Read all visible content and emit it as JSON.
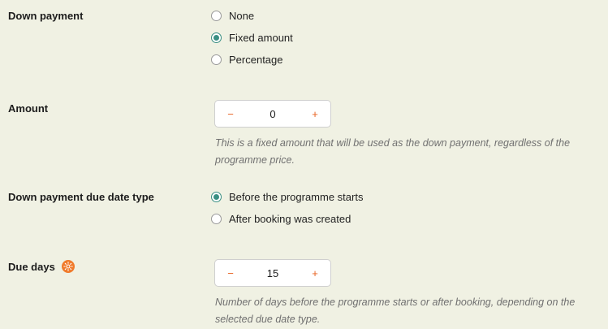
{
  "down_payment": {
    "label": "Down payment",
    "options": [
      {
        "label": "None",
        "checked": false
      },
      {
        "label": "Fixed amount",
        "checked": true
      },
      {
        "label": "Percentage",
        "checked": false
      }
    ]
  },
  "amount": {
    "label": "Amount",
    "value": "0",
    "decrement_symbol": "−",
    "increment_symbol": "+",
    "help": "This is a fixed amount that will be used as the down payment, regardless of the programme price."
  },
  "due_date_type": {
    "label": "Down payment due date type",
    "options": [
      {
        "label": "Before the programme starts",
        "checked": true
      },
      {
        "label": "After booking was created",
        "checked": false
      }
    ]
  },
  "due_days": {
    "label": "Due days",
    "info_icon": "sun-icon",
    "value": "15",
    "decrement_symbol": "−",
    "increment_symbol": "+",
    "help": "Number of days before the programme starts or after booking, depending on the selected due date type."
  },
  "colors": {
    "background": "#f0f1e3",
    "accent": "#3a8f83",
    "stepper_button": "#e8611f",
    "info_icon": "#f07a2a"
  }
}
